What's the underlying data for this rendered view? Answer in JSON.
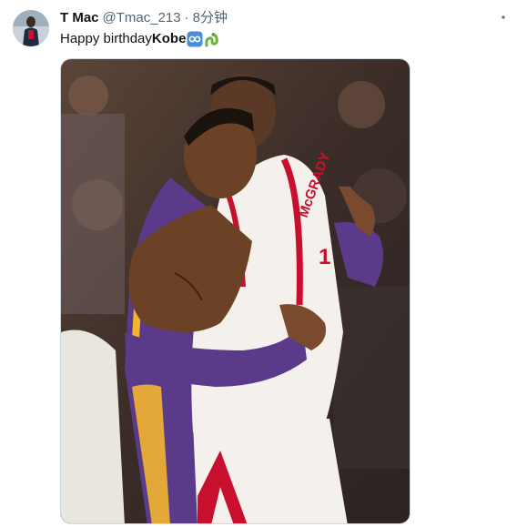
{
  "author": {
    "name": "T Mac",
    "handle": "@Tmac_213",
    "separator": "·",
    "time": "8分钟"
  },
  "tweet": {
    "text_prefix": "Happy birthday ",
    "text_bold": "Kobe"
  },
  "icons": {
    "more": "more-options-icon",
    "emoji_1": "infinity-emoji",
    "emoji_2": "snake-emoji"
  },
  "jersey": {
    "name": "McGRADY",
    "number": "1"
  },
  "colors": {
    "text_primary": "#0f1419",
    "text_secondary": "#536471",
    "lakers_purple": "#5b3a8a",
    "lakers_gold": "#f2b52f",
    "rockets_red": "#c8102e",
    "rockets_white": "#f4f1ec"
  }
}
